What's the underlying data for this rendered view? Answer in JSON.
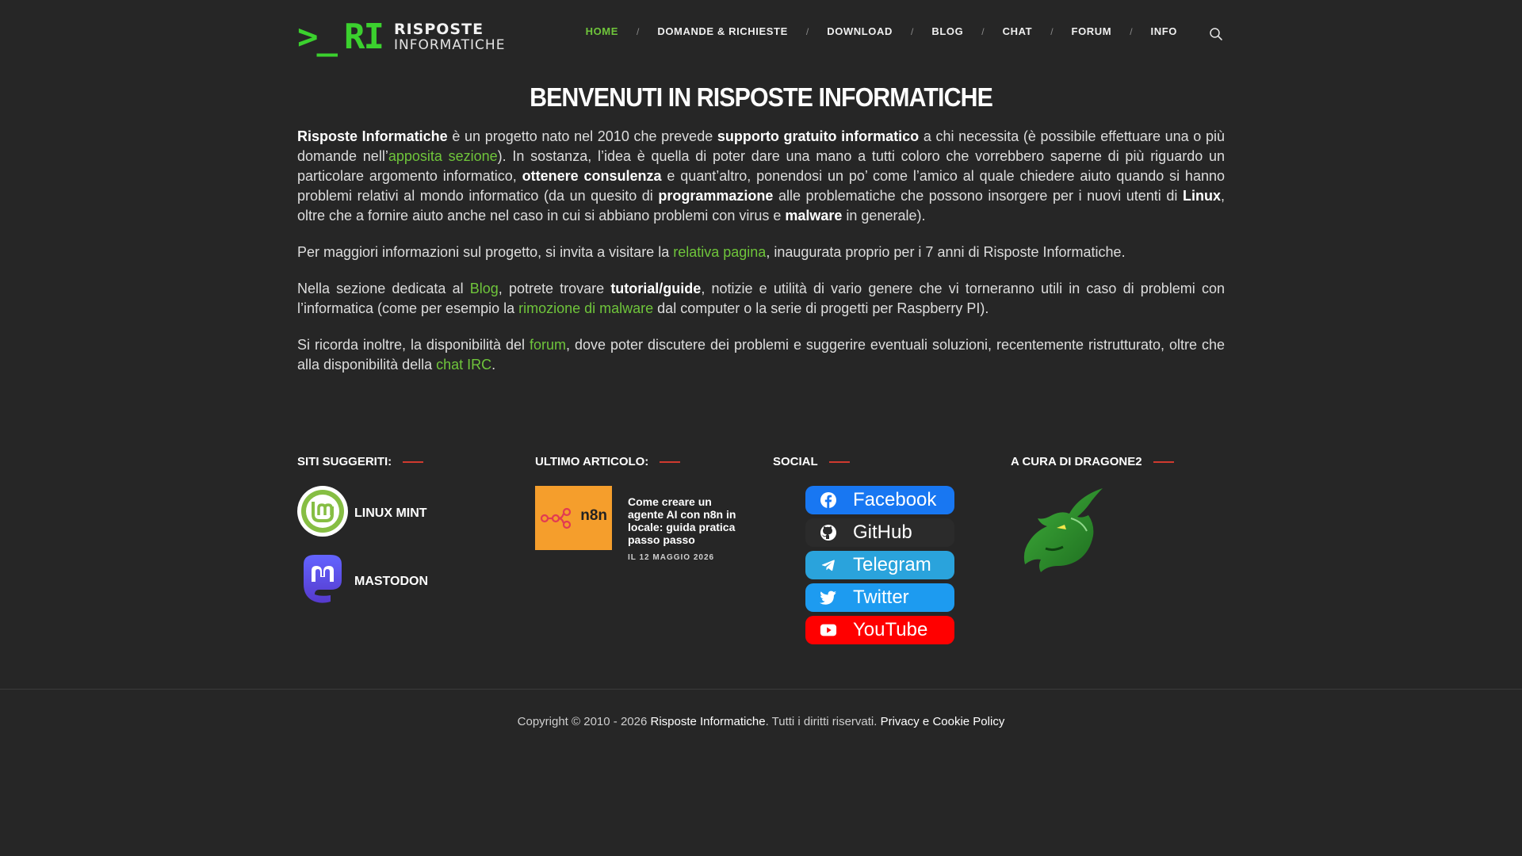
{
  "logo": {
    "mark_prompt": ">_",
    "mark_letters": "RI",
    "line1": "RISPOSTE",
    "line2": "INFORMATICHE"
  },
  "nav": [
    {
      "label": "HOME",
      "active": true
    },
    {
      "label": "DOMANDE & RICHIESTE"
    },
    {
      "label": "DOWNLOAD"
    },
    {
      "label": "BLOG"
    },
    {
      "label": "CHAT"
    },
    {
      "label": "FORUM"
    },
    {
      "label": "INFO"
    }
  ],
  "nav_sep": "/",
  "main": {
    "title": "BENVENUTI IN RISPOSTE INFORMATICHE",
    "p1": {
      "b1": "Risposte Informatiche",
      "t1": " è un progetto nato nel 2010 che prevede ",
      "b2": "supporto gratuito informatico",
      "t2": " a chi necessita (è possibile effettuare una o più domande nell’",
      "l1": "apposita sezione",
      "t3": "). In sostanza, l’idea è quella di poter dare una mano a tutti coloro che vorrebbero saperne di più riguardo un particolare argomento informatico, ",
      "b3": "ottenere consulenza",
      "t4": " e quant’altro, ponendosi un po’ come l’amico al quale chiedere aiuto quando si hanno problemi relativi al mondo informatico (da un quesito di ",
      "b4": "programmazione",
      "t5": " alle problematiche che possono insorgere per i nuovi utenti di ",
      "b5": "Linux",
      "t6": ", oltre che a fornire aiuto anche nel caso in cui si abbiano problemi con virus e ",
      "b6": "malware",
      "t7": " in generale)."
    },
    "p2": {
      "t1": "Per maggiori informazioni sul progetto, si invita a visitare la ",
      "l1": "relativa pagina",
      "t2": ", inaugurata proprio per i 7 anni di Risposte Informatiche."
    },
    "p3": {
      "t1": "Nella sezione dedicata al ",
      "l1": "Blog",
      "t2": ", potrete trovare ",
      "b1": "tutorial/guide",
      "t3": ", notizie e utilità di vario genere che vi torneranno utili in caso di problemi con l’informatica (come per esempio la ",
      "l2": "rimozione di malware",
      "t4": " dal computer o la serie di progetti per Raspberry PI)."
    },
    "p4": {
      "t1": "Si ricorda inoltre, la disponibilità del ",
      "l1": "forum",
      "t2": ", dove poter discutere dei problemi e suggerire eventuali soluzioni, recentemente ristrutturato, oltre che alla disponibilità della ",
      "l2": "chat IRC",
      "t3": "."
    }
  },
  "widgets": {
    "sites": {
      "title": "SITI SUGGERITI:",
      "items": [
        "LINUX MINT",
        "MASTODON"
      ]
    },
    "article": {
      "title": "ULTIMO ARTICOLO:",
      "thumb_text": "n8n",
      "headline": "Come creare un agente AI con n8n in locale: guida pratica passo passo",
      "date": "IL 12 MAGGIO 2026"
    },
    "social": {
      "title": "SOCIAL",
      "items": [
        {
          "label": "Facebook",
          "color": "#1877f2",
          "icon": "facebook-icon"
        },
        {
          "label": "GitHub",
          "color": "#2b2b2b",
          "icon": "github-icon"
        },
        {
          "label": "Telegram",
          "color": "#2aa3dc",
          "icon": "telegram-icon"
        },
        {
          "label": "Twitter",
          "color": "#1d9bf0",
          "icon": "twitter-icon"
        },
        {
          "label": "YouTube",
          "color": "#ff0000",
          "icon": "youtube-icon"
        }
      ]
    },
    "author": {
      "title": "A CURA DI DRAGONE2"
    }
  },
  "footer": {
    "t1": "Copyright © 2010 - 2026 ",
    "h1": "Risposte Informatiche",
    "t2": ". Tutti i diritti riservati. ",
    "h2": "Privacy e Cookie Policy"
  },
  "colors": {
    "background": "#262626",
    "accent_green": "#6fc53b",
    "logo_green": "#3bd12e",
    "title_dash": "#d03a2f"
  }
}
